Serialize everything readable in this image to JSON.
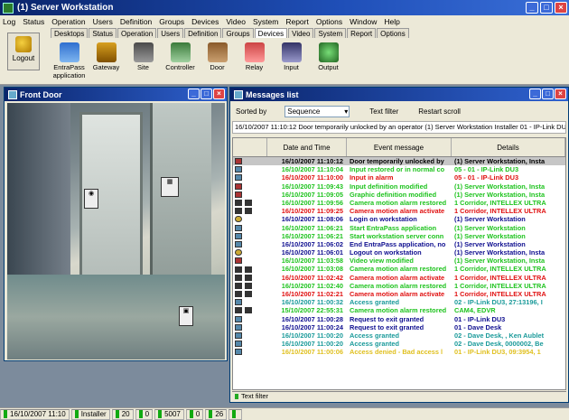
{
  "app": {
    "title": "(1)  Server Workstation"
  },
  "window_controls": {
    "min": "_",
    "max": "□",
    "close": "×"
  },
  "menu": [
    "Log",
    "Status",
    "Operation",
    "Users",
    "Definition",
    "Groups",
    "Devices",
    "Video",
    "System",
    "Report",
    "Options",
    "Window",
    "Help"
  ],
  "toolbar": {
    "logout_label": "Logout",
    "tabs": [
      "Desktops",
      "Status",
      "Operation",
      "Users",
      "Definition",
      "Groups",
      "Devices",
      "Video",
      "System",
      "Report",
      "Options"
    ],
    "active_tab": "Devices",
    "tools": [
      {
        "label": "EntraPass application",
        "icon": "entrapass-icon"
      },
      {
        "label": "Gateway",
        "icon": "gateway-icon"
      },
      {
        "label": "Site",
        "icon": "site-icon"
      },
      {
        "label": "Controller",
        "icon": "controller-icon"
      },
      {
        "label": "Door",
        "icon": "door-icon"
      },
      {
        "label": "Relay",
        "icon": "relay-icon"
      },
      {
        "label": "Input",
        "icon": "input-icon"
      },
      {
        "label": "Output",
        "icon": "output-icon"
      }
    ]
  },
  "front_door": {
    "title": "Front Door"
  },
  "messages": {
    "title": "Messages list",
    "sorted_by_label": "Sorted by",
    "sort_value": "Sequence",
    "text_filter_link": "Text filter",
    "restart_scroll_link": "Restart scroll",
    "last_message": "16/10/2007 11:10:12  Door temporarily unlocked by an operator  (1)  Server Workstation  Installer  01 - IP-Link DU3",
    "columns": [
      "Date and Time",
      "Event message",
      "Details"
    ],
    "rows": [
      {
        "icon": "door",
        "cam": false,
        "date": "16/10/2007 11:10:12",
        "event": "Door temporarily unlocked by",
        "details": "(1)  Server Workstation, Insta",
        "color": "#000000",
        "selected": true
      },
      {
        "icon": "pc",
        "cam": false,
        "date": "16/10/2007 11:10:04",
        "event": "Input restored or in normal co",
        "details": "05 - 01 - IP-Link DU3",
        "color": "#1ec31e"
      },
      {
        "icon": "pc",
        "cam": false,
        "date": "16/10/2007 11:10:00",
        "event": "Input in alarm",
        "details": "05 - 01 - IP-Link DU3",
        "color": "#e01010"
      },
      {
        "icon": "door",
        "cam": false,
        "date": "16/10/2007 11:09:43",
        "event": "Input definition modified",
        "details": "(1)  Server Workstation, Insta",
        "color": "#1ec31e"
      },
      {
        "icon": "door",
        "cam": false,
        "date": "16/10/2007 11:09:05",
        "event": "Graphic definition modified",
        "details": "(1)  Server Workstation, Insta",
        "color": "#1ec31e"
      },
      {
        "icon": "cam",
        "cam": true,
        "date": "16/10/2007 11:09:56",
        "event": "Camera motion alarm restored",
        "details": "1 Corridor, INTELLEX ULTRA",
        "color": "#1ec31e"
      },
      {
        "icon": "cam",
        "cam": true,
        "date": "16/10/2007 11:09:25",
        "event": "Camera motion alarm activate",
        "details": "1 Corridor, INTELLEX ULTRA",
        "color": "#e01010"
      },
      {
        "icon": "user",
        "cam": false,
        "date": "16/10/2007 11:08:06",
        "event": "Login on workstation",
        "details": "(1)  Server Workstation",
        "color": "#101090"
      },
      {
        "icon": "pc",
        "cam": false,
        "date": "16/10/2007 11:06:21",
        "event": "Start EntraPass application",
        "details": "(1)  Server Workstation",
        "color": "#1ec31e"
      },
      {
        "icon": "pc",
        "cam": false,
        "date": "16/10/2007 11:06:21",
        "event": "Start workstation server conn",
        "details": "(1)  Server Workstation",
        "color": "#1ec31e"
      },
      {
        "icon": "pc",
        "cam": false,
        "date": "16/10/2007 11:06:02",
        "event": "End EntraPass application, no",
        "details": "(1)  Server Workstation",
        "color": "#101090"
      },
      {
        "icon": "user",
        "cam": false,
        "date": "16/10/2007 11:06:01",
        "event": "Logout on workstation",
        "details": "(1)  Server Workstation, Insta",
        "color": "#101090"
      },
      {
        "icon": "door",
        "cam": false,
        "date": "16/10/2007 11:03:58",
        "event": "Video view modified",
        "details": "(1)  Server Workstation, Insta",
        "color": "#1ec31e"
      },
      {
        "icon": "cam",
        "cam": true,
        "date": "16/10/2007 11:03:08",
        "event": "Camera motion alarm restored",
        "details": "1 Corridor, INTELLEX ULTRA",
        "color": "#1ec31e"
      },
      {
        "icon": "cam",
        "cam": true,
        "date": "16/10/2007 11:02:42",
        "event": "Camera motion alarm activate",
        "details": "1 Corridor, INTELLEX ULTRA",
        "color": "#e01010"
      },
      {
        "icon": "cam",
        "cam": true,
        "date": "16/10/2007 11:02:40",
        "event": "Camera motion alarm restored",
        "details": "1 Corridor, INTELLEX ULTRA",
        "color": "#1ec31e"
      },
      {
        "icon": "cam",
        "cam": true,
        "date": "16/10/2007 11:02:21",
        "event": "Camera motion alarm activate",
        "details": "1 Corridor, INTELLEX ULTRA",
        "color": "#e01010"
      },
      {
        "icon": "pc",
        "cam": false,
        "date": "16/10/2007 11:00:32",
        "event": "Access granted",
        "details": "02 - IP-Link DU3, 27:13196, I",
        "color": "#1a9a9a"
      },
      {
        "icon": "cam",
        "cam": true,
        "date": "15/10/2007 22:55:31",
        "event": "Camera motion alarm restored",
        "details": "CAM4, EDVR",
        "color": "#1ec31e"
      },
      {
        "icon": "pc",
        "cam": false,
        "date": "16/10/2007 11:00:28",
        "event": "Request to exit granted",
        "details": "01 - IP-Link DU3",
        "color": "#101090"
      },
      {
        "icon": "pc",
        "cam": false,
        "date": "16/10/2007 11:00:24",
        "event": "Request to exit granted",
        "details": "01 - Dave Desk",
        "color": "#101090"
      },
      {
        "icon": "pc",
        "cam": false,
        "date": "16/10/2007 11:00:20",
        "event": "Access granted",
        "details": "02 - Dave Desk, , Ken Aublet",
        "color": "#1a9a9a"
      },
      {
        "icon": "pc",
        "cam": false,
        "date": "16/10/2007 11:00:20",
        "event": "Access granted",
        "details": "02 - Dave Desk, 0000002, Be",
        "color": "#1a9a9a"
      },
      {
        "icon": "pc",
        "cam": false,
        "date": "16/10/2007 11:00:06",
        "event": "Access denied - Bad access l",
        "details": "01 - IP-Link DU3, 09:3954, 1",
        "color": "#e0c020"
      }
    ],
    "status_text": "Text filter"
  },
  "statusbar": [
    {
      "text": "16/10/2007 11:10"
    },
    {
      "text": "Installer"
    },
    {
      "text": "20"
    },
    {
      "text": "0"
    },
    {
      "text": "5007"
    },
    {
      "text": "0"
    },
    {
      "text": "26"
    },
    {
      "text": ""
    }
  ],
  "colors": {
    "title_bar": "#0a246a",
    "green": "#1ec31e",
    "red": "#e01010",
    "blue": "#101090",
    "teal": "#1a9a9a",
    "yellow": "#e0c020"
  }
}
